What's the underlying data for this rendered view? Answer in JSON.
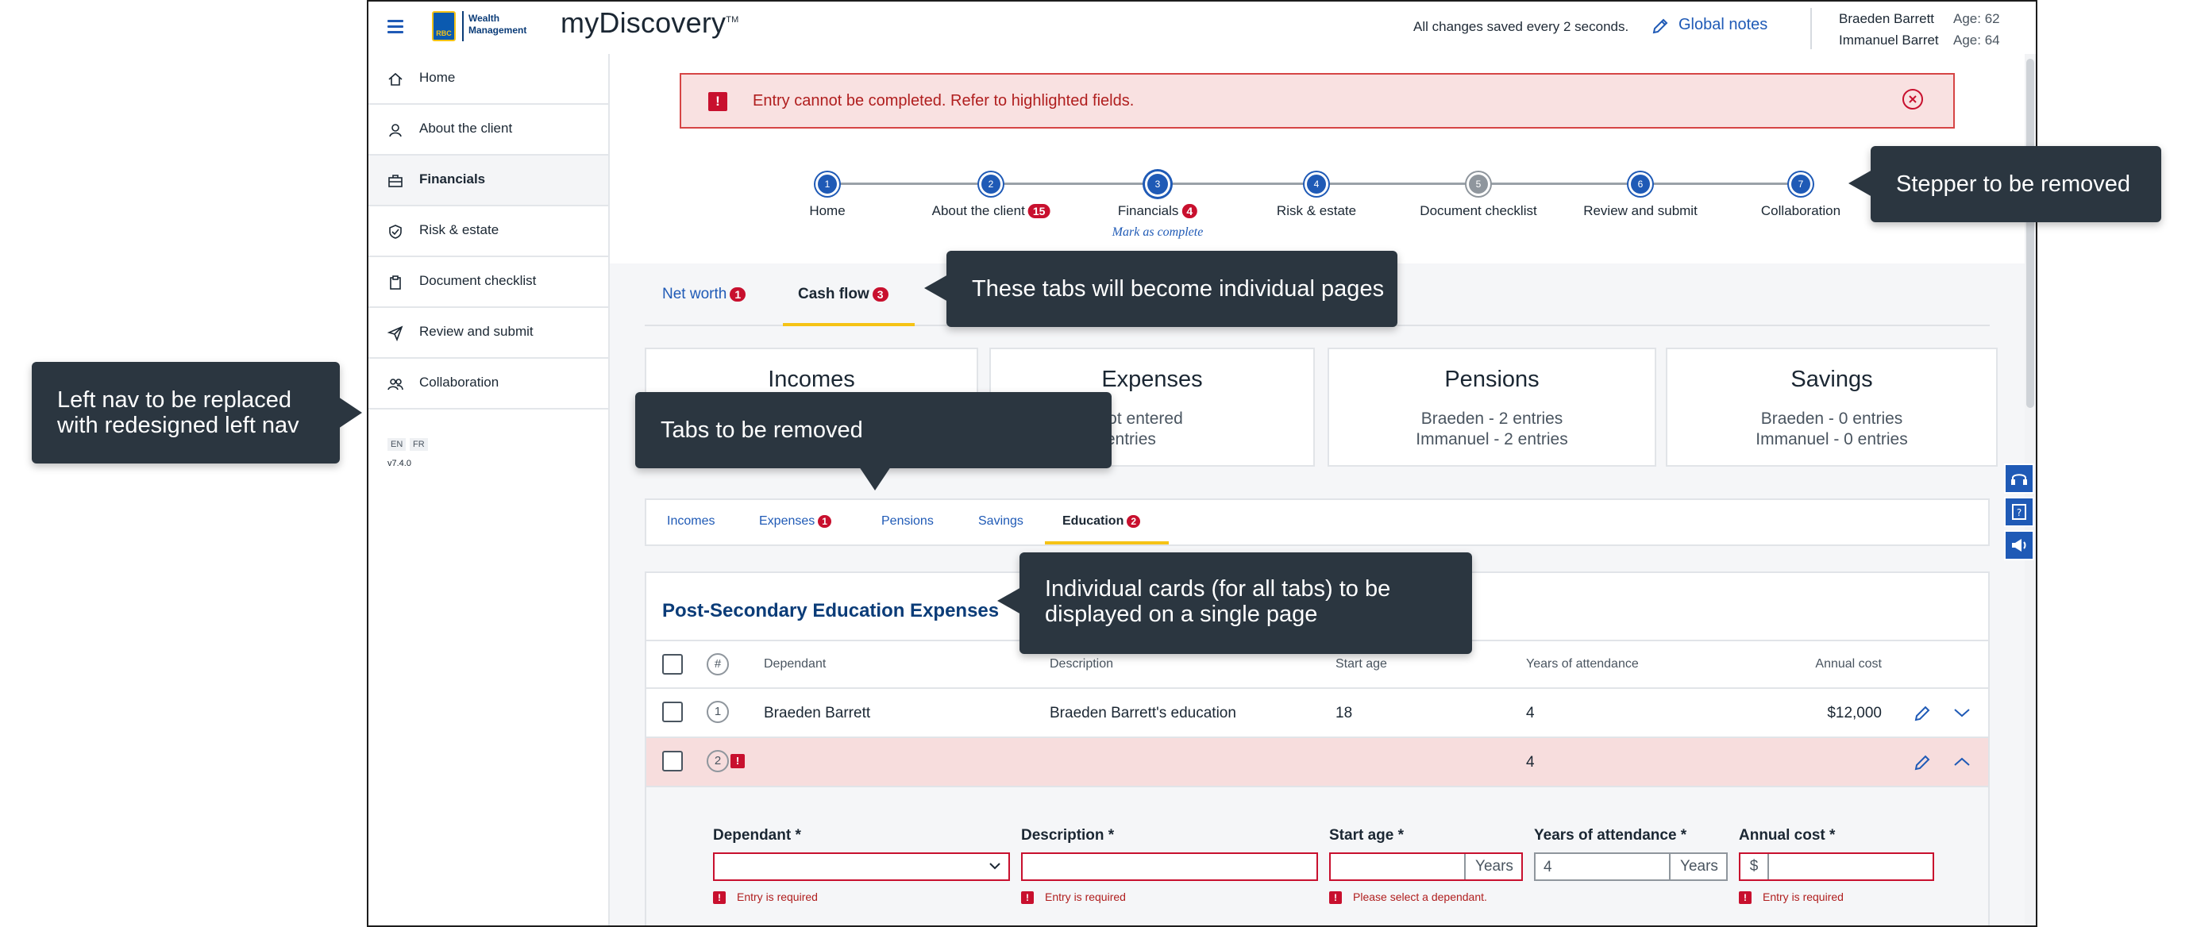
{
  "header": {
    "brand_line1": "Wealth",
    "brand_line2": "Management",
    "logo_mark": "RBC",
    "app_name": "myDiscovery",
    "app_tm": "TM",
    "saved_text": "All changes saved every 2 seconds.",
    "global_notes": "Global notes",
    "clients": [
      {
        "name": "Braeden Barrett",
        "age": "Age: 62"
      },
      {
        "name": "Immanuel Barret",
        "age": "Age: 64"
      }
    ]
  },
  "sidebar": {
    "items": [
      {
        "label": "Home",
        "icon": "home-icon"
      },
      {
        "label": "About the client",
        "icon": "person-icon"
      },
      {
        "label": "Financials",
        "icon": "briefcase-icon"
      },
      {
        "label": "Risk & estate",
        "icon": "shield-icon"
      },
      {
        "label": "Document checklist",
        "icon": "clipboard-icon"
      },
      {
        "label": "Review and submit",
        "icon": "send-icon"
      },
      {
        "label": "Collaboration",
        "icon": "group-icon"
      }
    ],
    "lang_en": "EN",
    "lang_fr": "FR",
    "version": "v7.4.0"
  },
  "error_banner": {
    "icon": "!",
    "message": "Entry cannot be completed. Refer to highlighted fields."
  },
  "stepper": {
    "steps": [
      {
        "num": "1",
        "label": "Home",
        "badge": ""
      },
      {
        "num": "2",
        "label": "About the client",
        "badge": "15"
      },
      {
        "num": "3",
        "label": "Financials",
        "badge": "4"
      },
      {
        "num": "4",
        "label": "Risk & estate",
        "badge": ""
      },
      {
        "num": "5",
        "label": "Document checklist",
        "badge": ""
      },
      {
        "num": "6",
        "label": "Review and submit",
        "badge": ""
      },
      {
        "num": "7",
        "label": "Collaboration",
        "badge": ""
      }
    ],
    "mark_complete": "Mark as complete"
  },
  "page_tabs": [
    {
      "label": "Net worth",
      "badge": "1"
    },
    {
      "label": "Cash flow",
      "badge": "3"
    }
  ],
  "summary_cards": [
    {
      "title": "Incomes",
      "line1": "",
      "line2": ""
    },
    {
      "title": "Expenses",
      "line1": "yle - not entered",
      "line2": "er - 0 entries"
    },
    {
      "title": "Pensions",
      "line1": "Braeden - 2 entries",
      "line2": "Immanuel - 2 entries"
    },
    {
      "title": "Savings",
      "line1": "Braeden - 0 entries",
      "line2": "Immanuel - 0 entries"
    }
  ],
  "sub_tabs": [
    {
      "label": "Incomes",
      "badge": ""
    },
    {
      "label": "Expenses",
      "badge": "1"
    },
    {
      "label": "Pensions",
      "badge": ""
    },
    {
      "label": "Savings",
      "badge": ""
    },
    {
      "label": "Education",
      "badge": "2"
    }
  ],
  "education": {
    "title": "Post-Secondary Education Expenses",
    "columns": {
      "num": "#",
      "dependant": "Dependant",
      "description": "Description",
      "start_age": "Start age",
      "years": "Years of attendance",
      "cost": "Annual cost"
    },
    "rows": [
      {
        "num": "1",
        "dependant": "Braeden Barrett",
        "description": "Braeden Barrett's education",
        "start_age": "18",
        "years": "4",
        "cost": "$12,000"
      },
      {
        "num": "2",
        "dependant": "",
        "description": "",
        "start_age": "",
        "years": "4",
        "cost": ""
      }
    ],
    "form": {
      "dependant_label": "Dependant *",
      "description_label": "Description *",
      "start_age_label": "Start age *",
      "years_label": "Years of attendance *",
      "cost_label": "Annual cost *",
      "years_value": "4",
      "years_unit": "Years",
      "currency": "$",
      "err_required": "Entry is required",
      "err_dependant": "Please select a dependant."
    }
  },
  "callouts": {
    "stepper": "Stepper to be removed",
    "tabs_pages": "These tabs will become individual pages",
    "tabs_removed": "Tabs to be removed",
    "left_nav_1": "Left nav to be replaced",
    "left_nav_2": "with redesigned left nav",
    "cards_1": "Individual cards (for all tabs) to be",
    "cards_2": "displayed on a single page"
  },
  "colors": {
    "accent": "#1f5ab6",
    "error": "#c8102e",
    "tab_underline": "#f5c316",
    "callout_bg": "#2b3640",
    "brand_navy": "#0b3c78"
  }
}
